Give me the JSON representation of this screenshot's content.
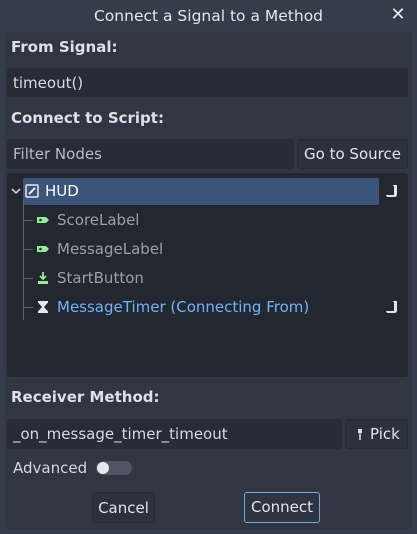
{
  "dialog": {
    "title": "Connect a Signal to a Method",
    "close_symbol": "✕"
  },
  "from_signal": {
    "label": "From Signal:",
    "value": "timeout()"
  },
  "connect_to_script": {
    "label": "Connect to Script:",
    "filter_placeholder": "Filter Nodes",
    "go_to_source_label": "Go to Source"
  },
  "tree": {
    "nodes": [
      {
        "name": "HUD",
        "icon": "control-edit-icon",
        "selected": true,
        "has_script": true
      },
      {
        "name": "ScoreLabel",
        "icon": "label-icon",
        "dimmed": true
      },
      {
        "name": "MessageLabel",
        "icon": "label-icon",
        "dimmed": true
      },
      {
        "name": "StartButton",
        "icon": "button-icon",
        "dimmed": true
      },
      {
        "name": "MessageTimer (Connecting From)",
        "icon": "timer-icon",
        "highlight": true,
        "has_script": true
      }
    ]
  },
  "receiver": {
    "label": "Receiver Method:",
    "value": "_on_message_timer_timeout",
    "pick_label": "Pick"
  },
  "advanced": {
    "label": "Advanced",
    "enabled": false
  },
  "actions": {
    "cancel_label": "Cancel",
    "connect_label": "Connect"
  },
  "colors": {
    "label_icon_green": "#8eef97",
    "highlight_blue": "#6fb4f7",
    "selection": "#3a5577"
  }
}
